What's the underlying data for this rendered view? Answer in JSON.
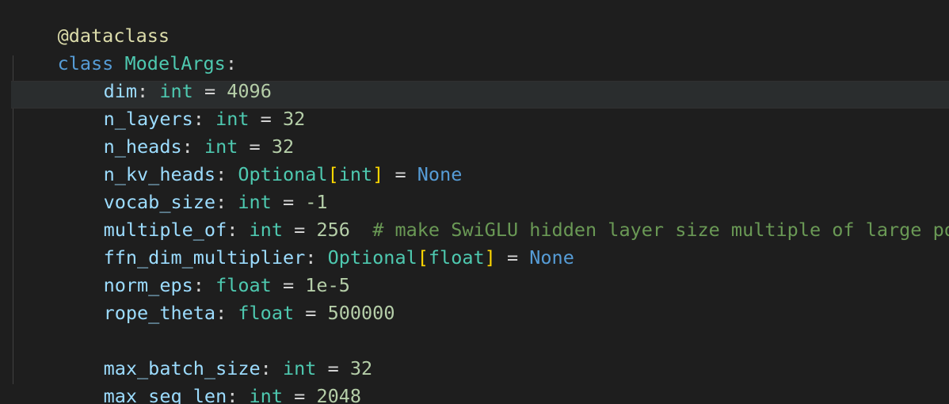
{
  "colors": {
    "background": "#1e1e1e",
    "decorator": "#dcdcaa",
    "keyword": "#569cd6",
    "class_name": "#4ec9b0",
    "variable": "#9cdcfe",
    "type": "#4ec9b0",
    "number": "#b5cea8",
    "constant": "#569cd6",
    "bracket": "#ffd700",
    "comment": "#6a9955"
  },
  "code": {
    "decorator": "@dataclass",
    "class_keyword": "class",
    "class_name": "ModelArgs",
    "fields": [
      {
        "name": "dim",
        "type": "int",
        "value": "4096"
      },
      {
        "name": "n_layers",
        "type": "int",
        "value": "32"
      },
      {
        "name": "n_heads",
        "type": "int",
        "value": "32"
      },
      {
        "name": "n_kv_heads",
        "wrapper": "Optional",
        "type": "int",
        "value": "None"
      },
      {
        "name": "vocab_size",
        "type": "int",
        "value": "-1"
      },
      {
        "name": "multiple_of",
        "type": "int",
        "value": "256",
        "comment": "# make SwiGLU hidden layer size multiple of large powe"
      },
      {
        "name": "ffn_dim_multiplier",
        "wrapper": "Optional",
        "type": "float",
        "value": "None"
      },
      {
        "name": "norm_eps",
        "type": "float",
        "value": "1e-5"
      },
      {
        "name": "rope_theta",
        "type": "float",
        "value": "500000"
      },
      {
        "name": "max_batch_size",
        "type": "int",
        "value": "32"
      },
      {
        "name": "max_seq_len",
        "type": "int",
        "value": "2048"
      }
    ]
  }
}
